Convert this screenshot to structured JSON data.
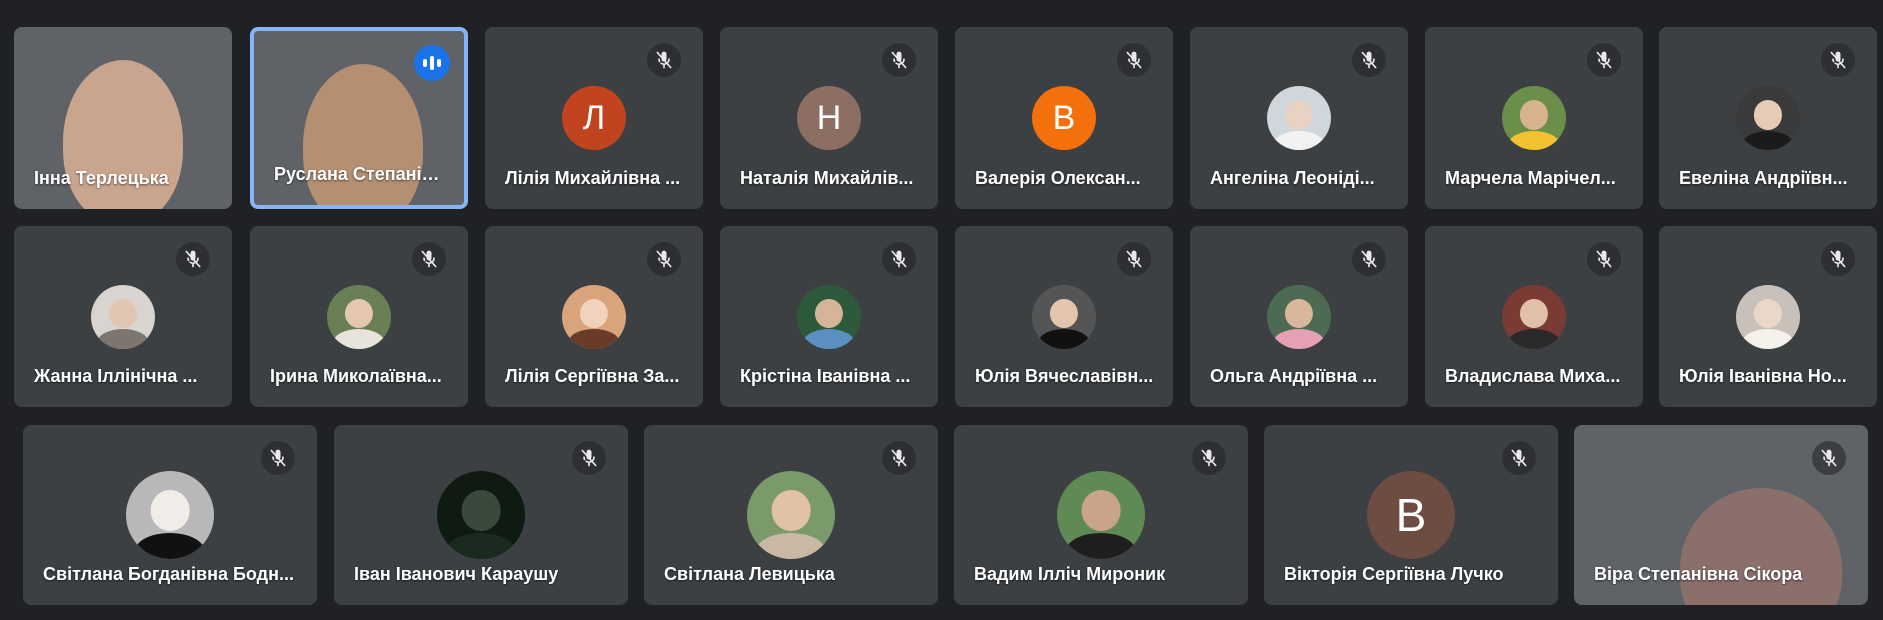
{
  "participants": [
    {
      "name": "Інна Терлецька",
      "kind": "video",
      "bg": "bg-v1",
      "muted": false,
      "speaking": false
    },
    {
      "name": "Руслана Степанівна...",
      "kind": "video",
      "bg": "bg-v2",
      "muted": false,
      "speaking": true
    },
    {
      "name": "Лілія Михайлівна ...",
      "kind": "letter",
      "letter": "Л",
      "color": "#c1441f",
      "muted": true
    },
    {
      "name": "Наталія Михайлів...",
      "kind": "letter",
      "letter": "Н",
      "color": "#8d6e63",
      "muted": true
    },
    {
      "name": "Валерія Олексан...",
      "kind": "letter",
      "letter": "В",
      "color": "#f4700c",
      "muted": true
    },
    {
      "name": "Ангеліна Леоніді...",
      "kind": "photo",
      "face": "#e8d2c4",
      "body": "#f2f2f2",
      "bgc": "#cfd6dc",
      "muted": true
    },
    {
      "name": "Марчела Марічел...",
      "kind": "photo",
      "face": "#d8b48e",
      "body": "#f2c230",
      "bgc": "#6b8f4a",
      "muted": true
    },
    {
      "name": "Евеліна Андріївн...",
      "kind": "photo",
      "face": "#e6cbb6",
      "body": "#1b1b1b",
      "bgc": "#3a3a3a",
      "muted": true
    },
    {
      "name": "Жанна Іллінічна ...",
      "kind": "photo",
      "face": "#e2c6b4",
      "body": "#7d7670",
      "bgc": "#d8d4d0",
      "muted": true
    },
    {
      "name": "Ірина Миколаївна...",
      "kind": "photo",
      "face": "#e4c8ae",
      "body": "#e8e4dc",
      "bgc": "#6a7f54",
      "muted": true
    },
    {
      "name": "Лілія Сергіївна За...",
      "kind": "photo",
      "face": "#f0d2bd",
      "body": "#6b3b2a",
      "bgc": "#d9a37b",
      "muted": true
    },
    {
      "name": "Крістіна Іванівна ...",
      "kind": "photo",
      "face": "#d6b49a",
      "body": "#5b8fc2",
      "bgc": "#2d5a3a",
      "muted": true
    },
    {
      "name": "Юлія Вячеславівн...",
      "kind": "photo",
      "face": "#e3c5ae",
      "body": "#111111",
      "bgc": "#555555",
      "muted": true
    },
    {
      "name": "Ольга Андріївна ...",
      "kind": "photo",
      "face": "#d9b79c",
      "body": "#e6a0b4",
      "bgc": "#4d6a52",
      "muted": true
    },
    {
      "name": "Владислава Миха...",
      "kind": "photo",
      "face": "#e0c0a8",
      "body": "#2a2a2a",
      "bgc": "#7a3b35",
      "muted": true
    },
    {
      "name": "Юлія Іванівна Но...",
      "kind": "photo",
      "face": "#ead7c8",
      "body": "#f4f0ea",
      "bgc": "#c9c1b9",
      "muted": true
    },
    {
      "name": "Світлана Богданівна Бодн...",
      "kind": "photo",
      "face": "#f0ece8",
      "body": "#111111",
      "bgc": "#b8b8b8",
      "muted": true
    },
    {
      "name": "Іван Іванович Караушу",
      "kind": "photo",
      "face": "#3a4a3a",
      "body": "#1a2a1e",
      "bgc": "#0e1a12",
      "muted": true
    },
    {
      "name": "Світлана Левицька",
      "kind": "photo",
      "face": "#e2c2a6",
      "body": "#c9b9a4",
      "bgc": "#7a9a6a",
      "muted": true
    },
    {
      "name": "Вадим Ілліч Мироник",
      "kind": "photo",
      "face": "#c9a489",
      "body": "#1e1e1e",
      "bgc": "#5f8a54",
      "muted": true
    },
    {
      "name": "Вікторія Сергіївна Лучко",
      "kind": "letter",
      "letter": "В",
      "color": "#6d4c41",
      "muted": true,
      "big": true
    },
    {
      "name": "Віра Степанівна Сікора",
      "kind": "video",
      "bg": "bg-v3",
      "muted": true,
      "speaking": false
    }
  ]
}
